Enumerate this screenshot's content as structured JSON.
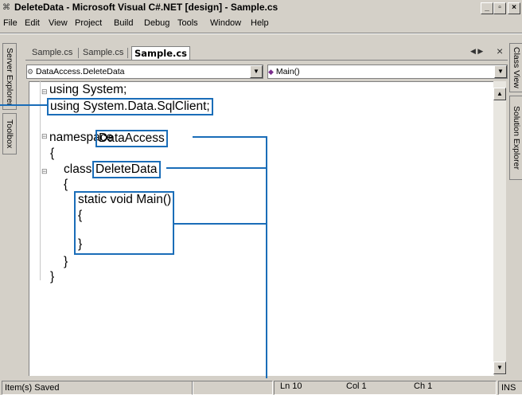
{
  "window": {
    "title": "DeleteData - Microsoft Visual C#.NET [design] - Sample.cs",
    "icon": "vs-icon",
    "controls": {
      "minimize": "_",
      "maximize": "\u0001",
      "close": "×"
    }
  },
  "menu": {
    "items": [
      {
        "label": "File"
      },
      {
        "label": "Edit"
      },
      {
        "label": "View"
      },
      {
        "label": "Project"
      },
      {
        "label": "Build"
      },
      {
        "label": "Debug"
      },
      {
        "label": "Tools"
      },
      {
        "label": "Window"
      },
      {
        "label": "Help"
      }
    ]
  },
  "left_panels": {
    "server_explorer": "Server Explorer",
    "toolbox": "Toolbox"
  },
  "right_panels": {
    "class_view": "Class View",
    "solution_explorer": "Solution Explorer"
  },
  "doc_tabs": [
    {
      "label": "Sample.cs"
    },
    {
      "label": "Sample.cs"
    },
    {
      "label": "Sample.cs",
      "active": true
    }
  ],
  "doc_tab_controls": {
    "nav": "◀ ▶",
    "close": "×"
  },
  "nav_combos": {
    "type": "DataAccess.DeleteData",
    "member": "Main()"
  },
  "code": {
    "line1": "using System;",
    "line2": "using System.Data.SqlClient;",
    "line3_kw": "namespace",
    "line3_name": "DataAccess",
    "brace_open": "{",
    "class_kw": "class",
    "class_name": "DeleteData",
    "method_sig": "static void Main()",
    "brace_close": "}"
  },
  "status": {
    "message": "Item(s) Saved",
    "ln": "Ln 10",
    "col": "Col 1",
    "ch": "Ch 1",
    "mode": "INS"
  },
  "colors": {
    "callout": "#1a6db8"
  }
}
